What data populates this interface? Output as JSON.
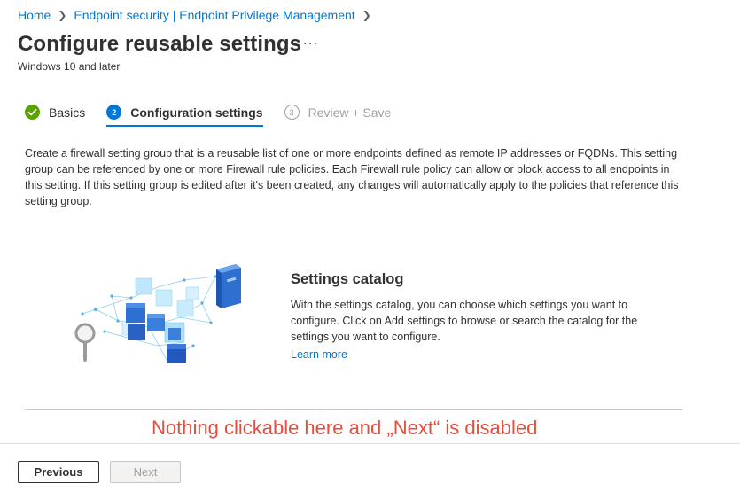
{
  "breadcrumb": {
    "items": [
      "Home",
      "Endpoint security | Endpoint Privilege Management"
    ]
  },
  "header": {
    "title": "Configure reusable settings",
    "more": "···",
    "subtitle": "Windows 10 and later"
  },
  "steps": [
    {
      "number": "",
      "label": "Basics",
      "state": "complete"
    },
    {
      "number": "2",
      "label": "Configuration settings",
      "state": "active"
    },
    {
      "number": "3",
      "label": "Review + Save",
      "state": "pending"
    }
  ],
  "description": "Create a firewall setting group that is a reusable list of one or more endpoints defined as remote IP addresses or FQDNs. This setting group can be referenced by one or more Firewall rule policies. Each Firewall rule policy can allow or block access to all endpoints in this setting. If this setting group is edited after it's been created, any changes will automatically apply to the policies that reference this setting group.",
  "catalog": {
    "title": "Settings catalog",
    "body": "With the settings catalog, you can choose which settings you want to configure. Click on Add settings to browse or search the catalog for the settings you want to configure.",
    "link": "Learn more",
    "icon": "settings-catalog-illustration"
  },
  "annotation": "Nothing clickable here and „Next“ is disabled",
  "footer": {
    "previous": "Previous",
    "next": "Next"
  },
  "colors": {
    "accent": "#0078d4",
    "success": "#57a300",
    "annotation": "#e74c3c"
  }
}
